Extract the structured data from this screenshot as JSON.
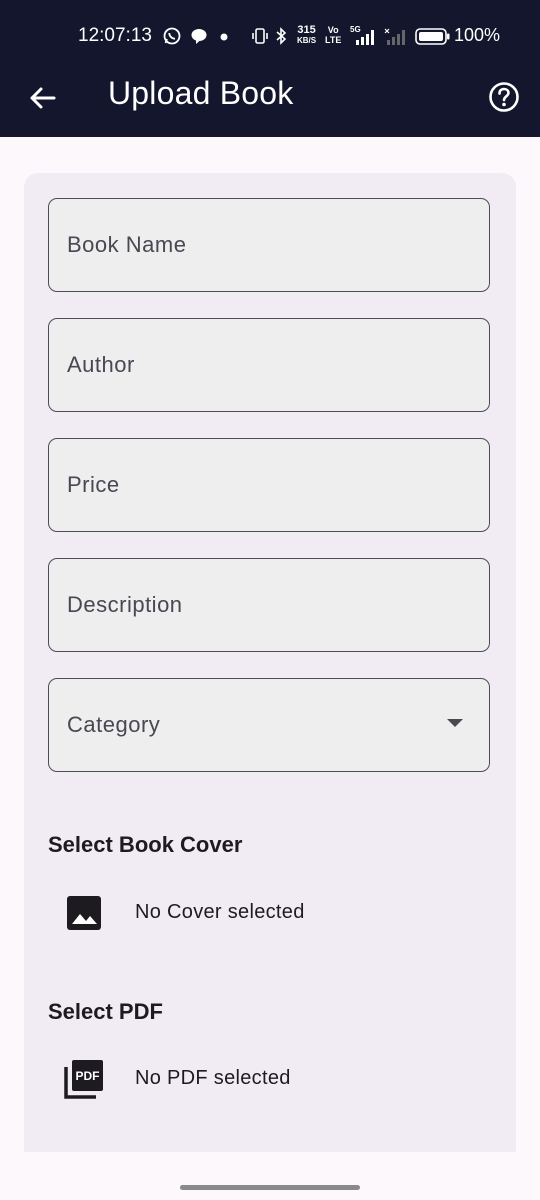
{
  "status_bar": {
    "time": "12:07:13",
    "speed_value": "315",
    "speed_unit": "KB/S",
    "volte_top": "Vo",
    "volte_bottom": "LTE",
    "network": "5G",
    "battery": "100%"
  },
  "app_bar": {
    "title": "Upload Book",
    "back_icon": "arrow-left-icon",
    "help_icon": "help-circle-icon"
  },
  "form": {
    "fields": [
      {
        "label": "Book Name"
      },
      {
        "label": "Author"
      },
      {
        "label": "Price"
      },
      {
        "label": "Description"
      }
    ],
    "category": {
      "label": "Category",
      "icon": "dropdown-arrow-icon"
    }
  },
  "cover_section": {
    "title": "Select Book Cover",
    "status": "No Cover selected",
    "icon": "image-icon"
  },
  "pdf_section": {
    "title": "Select PDF",
    "status": "No PDF selected",
    "icon": "pdf-file-icon",
    "icon_text": "PDF"
  },
  "colors": {
    "app_bar": "#13162d",
    "card": "#f1ecf4",
    "field_fill": "#eeeeee",
    "field_border": "#4f4a58"
  }
}
